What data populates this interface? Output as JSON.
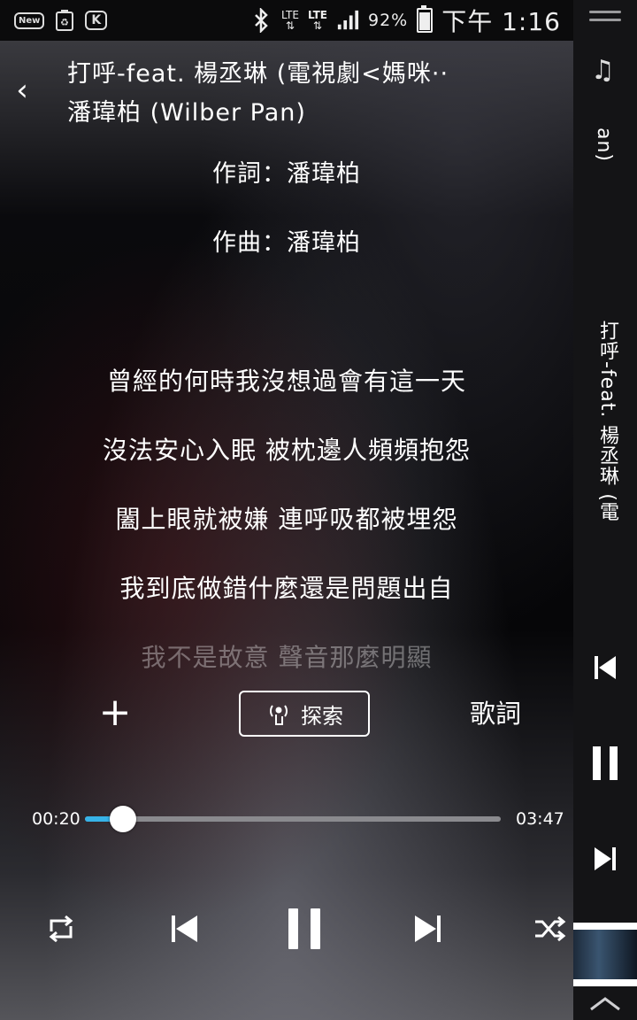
{
  "status_bar": {
    "new_badge": "New",
    "k_badge": "K",
    "lte_label_1": "LTE",
    "lte_label_2": "LTE",
    "battery": "92%",
    "time": "下午 1:16"
  },
  "player": {
    "title_line1": "打呼-feat. 楊丞琳 (電視劇<媽咪··",
    "title_line2": "潘瑋柏 (Wilber Pan)",
    "lyricist": "作詞：潘瑋柏",
    "composer": "作曲：潘瑋柏",
    "lyrics": [
      "曾經的何時我沒想過會有這一天",
      "沒法安心入眠 被枕邊人頻頻抱怨",
      "闔上眼就被嫌 連呼吸都被埋怨",
      "我到底做錯什麼還是問題出自"
    ],
    "lyric_faded": "我不是故意 聲音那麼明顯",
    "add_label": "+",
    "explore_label": "探索",
    "lyrics_button_label": "歌詞",
    "time_current": "00:20",
    "time_total": "03:47",
    "progress_fraction": 0.092
  },
  "sidebar": {
    "artist_fragment": "an)",
    "title_vertical": "打呼-feat. 楊丞琳 (電"
  }
}
